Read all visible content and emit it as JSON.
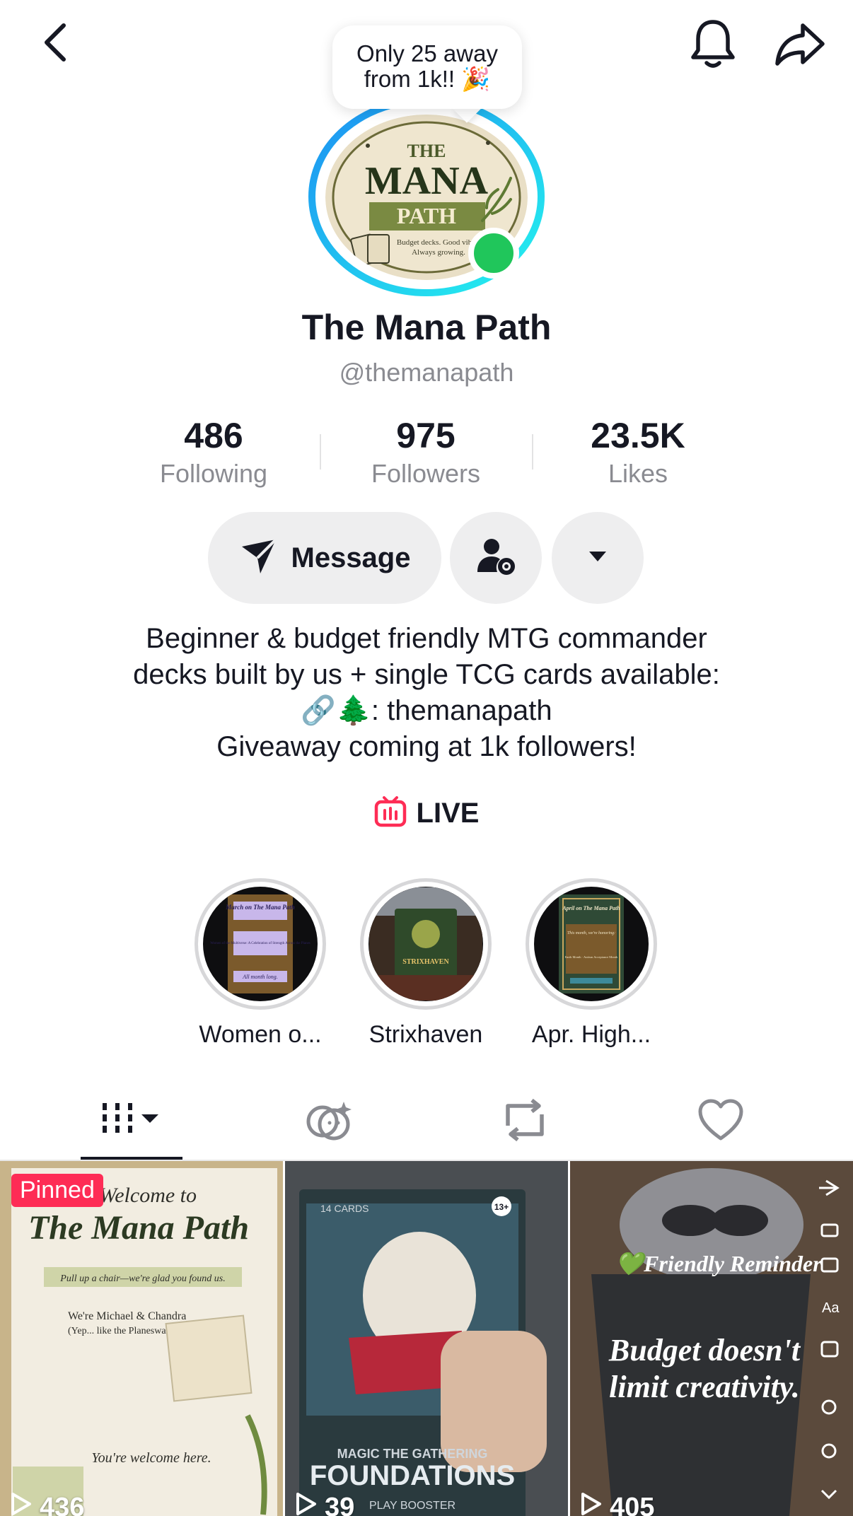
{
  "tooltip": {
    "line1": "Only 25 away",
    "line2": "from 1k!! 🎉"
  },
  "profile": {
    "name": "The Mana Path",
    "handle": "@themanapath",
    "logo": {
      "top": "THE",
      "middle": "MANA",
      "bottom": "PATH",
      "tagline1": "Budget decks. Good vibes.",
      "tagline2": "Always growing."
    }
  },
  "stats": [
    {
      "value": "486",
      "label": "Following"
    },
    {
      "value": "975",
      "label": "Followers"
    },
    {
      "value": "23.5K",
      "label": "Likes"
    }
  ],
  "actions": {
    "message_label": "Message"
  },
  "bio": {
    "line1": "Beginner & budget friendly MTG commander",
    "line2": "decks built by us + single TCG cards available:",
    "line3": "🔗🌲: themanapath",
    "line4": "Giveaway coming at 1k followers!"
  },
  "live": {
    "label": "LIVE"
  },
  "highlights": [
    {
      "label": "Women o...",
      "cover_title": "March on The Mana Path",
      "cover_sub": "Women of the Multiverse: A Celebration of Strength Across the Planes",
      "cover_foot": "All month long."
    },
    {
      "label": "Strixhaven",
      "cover_title": "STRIXHAVEN"
    },
    {
      "label": "Apr. High...",
      "cover_title": "April on The Mana Path",
      "cover_sub": "This month, we're honoring:",
      "cover_foot": "Earth Month · Autism Acceptance Month"
    }
  ],
  "videos": [
    {
      "pinned_label": "Pinned",
      "views": "436",
      "title_small": "Welcome to",
      "title_big": "The Mana Path",
      "subtitle": "Pull up a chair—we're glad you found us.",
      "text1": "We're Michael & Chandra",
      "text2": "(Yep... like the Planeswalker.)",
      "footer": "You're welcome here."
    },
    {
      "views": "39",
      "pack_count": "14 CARDS",
      "pack_brand": "MAGIC THE GATHERING",
      "pack_name": "FOUNDATIONS",
      "pack_type": "PLAY BOOSTER",
      "age": "13+"
    },
    {
      "views": "405",
      "overlay1": "💚Friendly Reminder",
      "overlay2": "Budget doesn't",
      "overlay3": "limit creativity."
    }
  ],
  "colors": {
    "accent": "#fe2c55",
    "online": "#20c65b",
    "ring_start": "#1da1f2",
    "ring_end": "#25f4ee"
  }
}
